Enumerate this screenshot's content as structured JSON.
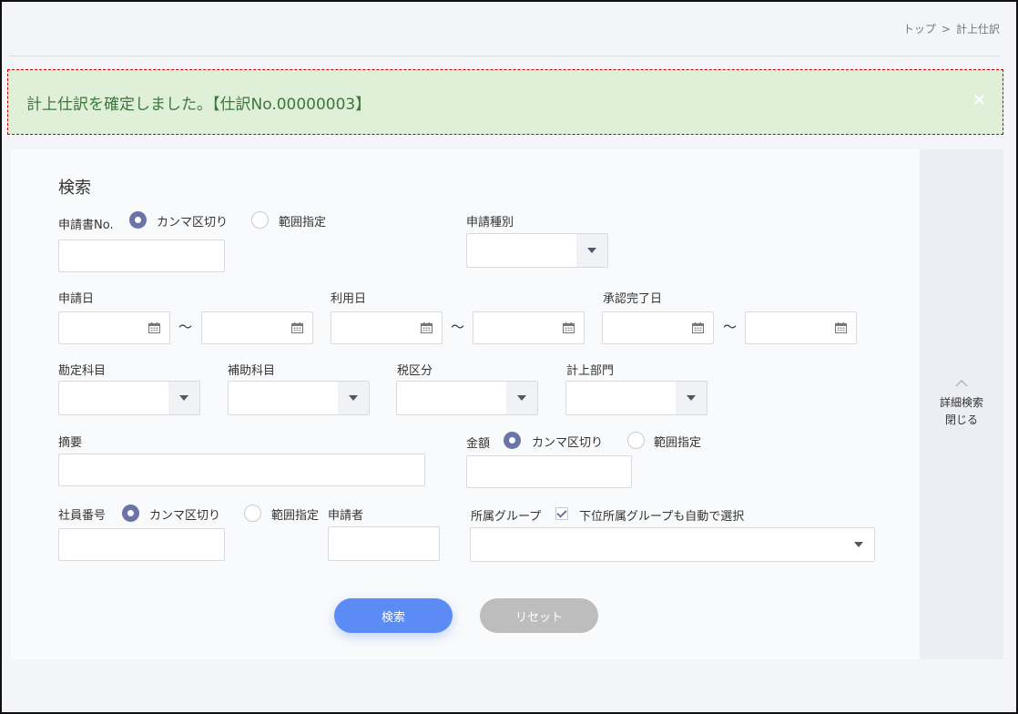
{
  "breadcrumb": {
    "home": "トップ",
    "separator": ">",
    "current": "計上仕訳"
  },
  "alert": {
    "message": "計上仕訳を確定しました。【仕訳No.00000003】",
    "close_icon": "×"
  },
  "search": {
    "title": "検索",
    "application_no": {
      "label": "申請書No.",
      "option_comma": "カンマ区切り",
      "option_range": "範囲指定",
      "value": ""
    },
    "application_type": {
      "label": "申請種別",
      "value": ""
    },
    "application_date": {
      "label": "申請日",
      "from": "",
      "to": ""
    },
    "usage_date": {
      "label": "利用日",
      "from": "",
      "to": ""
    },
    "approval_date": {
      "label": "承認完了日",
      "from": "",
      "to": ""
    },
    "range_separator": "～",
    "account": {
      "label": "勘定科目",
      "value": ""
    },
    "sub_account": {
      "label": "補助科目",
      "value": ""
    },
    "tax_category": {
      "label": "税区分",
      "value": ""
    },
    "department": {
      "label": "計上部門",
      "value": ""
    },
    "summary": {
      "label": "摘要",
      "value": ""
    },
    "amount": {
      "label": "金額",
      "option_comma": "カンマ区切り",
      "option_range": "範囲指定",
      "value": ""
    },
    "employee_no": {
      "label": "社員番号",
      "option_comma": "カンマ区切り",
      "option_range": "範囲指定",
      "value": ""
    },
    "applicant": {
      "label": "申請者",
      "value": ""
    },
    "group": {
      "label": "所属グループ",
      "checkbox_label": "下位所属グループも自動で選択",
      "checked": true,
      "value": ""
    },
    "search_button": "検索",
    "reset_button": "リセット"
  },
  "side_panel": {
    "line1": "詳細検索",
    "line2": "閉じる",
    "icon": "chevron-up-icon"
  },
  "colors": {
    "accent": "#6b74a6",
    "primary_button": "#5b8cf5",
    "alert_bg": "#dfefd8",
    "alert_text": "#3c763d"
  }
}
